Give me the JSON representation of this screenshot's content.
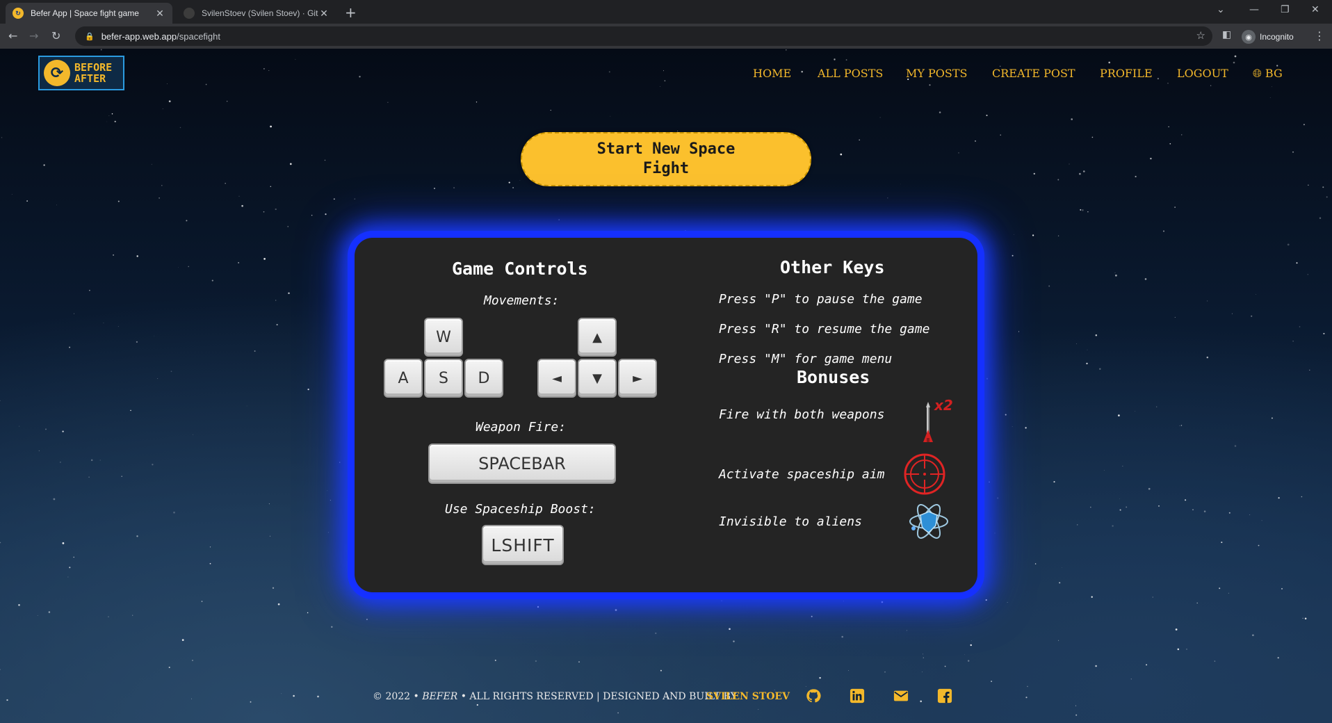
{
  "browser": {
    "tabs": [
      {
        "title": "Befer App | Space fight game",
        "close": "✕"
      },
      {
        "title": "SvilenStoev (Svilen Stoev) · GitHub",
        "close": "✕"
      }
    ],
    "new_tab": "+",
    "url_host": "befer-app.web.app",
    "url_path": "/spacefight",
    "profile_label": "Incognito"
  },
  "site": {
    "logo": {
      "line1": "BEFORE",
      "line2": "AFTER"
    },
    "nav": [
      {
        "label": "HOME"
      },
      {
        "label": "ALL POSTS"
      },
      {
        "label": "MY POSTS"
      },
      {
        "label": "CREATE POST"
      },
      {
        "label": "PROFILE"
      },
      {
        "label": "LOGOUT"
      },
      {
        "label": "BG"
      }
    ],
    "start_button": "Start New Space Fight"
  },
  "controls": {
    "title": "Game Controls",
    "movements_label": "Movements:",
    "wasd": [
      "W",
      "A",
      "S",
      "D"
    ],
    "arrows": [
      "▲",
      "◄",
      "▼",
      "►"
    ],
    "weapon_label": "Weapon Fire:",
    "weapon_key": "SPACEBAR",
    "boost_label": "Use Spaceship Boost:",
    "boost_key": "LSHIFT"
  },
  "other_keys": {
    "title": "Other Keys",
    "items": [
      "Press \"P\" to pause the game",
      "Press \"R\" to resume the game",
      "Press \"M\" for game menu"
    ]
  },
  "bonuses": {
    "title": "Bonuses",
    "items": [
      {
        "text": "Fire with both weapons",
        "icon": "double-rocket-icon",
        "badge": "x2"
      },
      {
        "text": "Activate spaceship aim",
        "icon": "crosshair-icon"
      },
      {
        "text": "Invisible to aliens",
        "icon": "atom-shield-icon"
      }
    ]
  },
  "footer": {
    "year": "© 2022 •",
    "brand": "BEFER",
    "rights": "• ALL RIGHTS RESERVED | DESIGNED AND BUILT BY",
    "author": "SVILEN STOEV",
    "social": [
      "github-icon",
      "linkedin-icon",
      "mail-icon",
      "facebook-icon"
    ]
  },
  "colors": {
    "accent": "#f3b82b",
    "panel": "#242424",
    "glow": "#1a3bff"
  }
}
